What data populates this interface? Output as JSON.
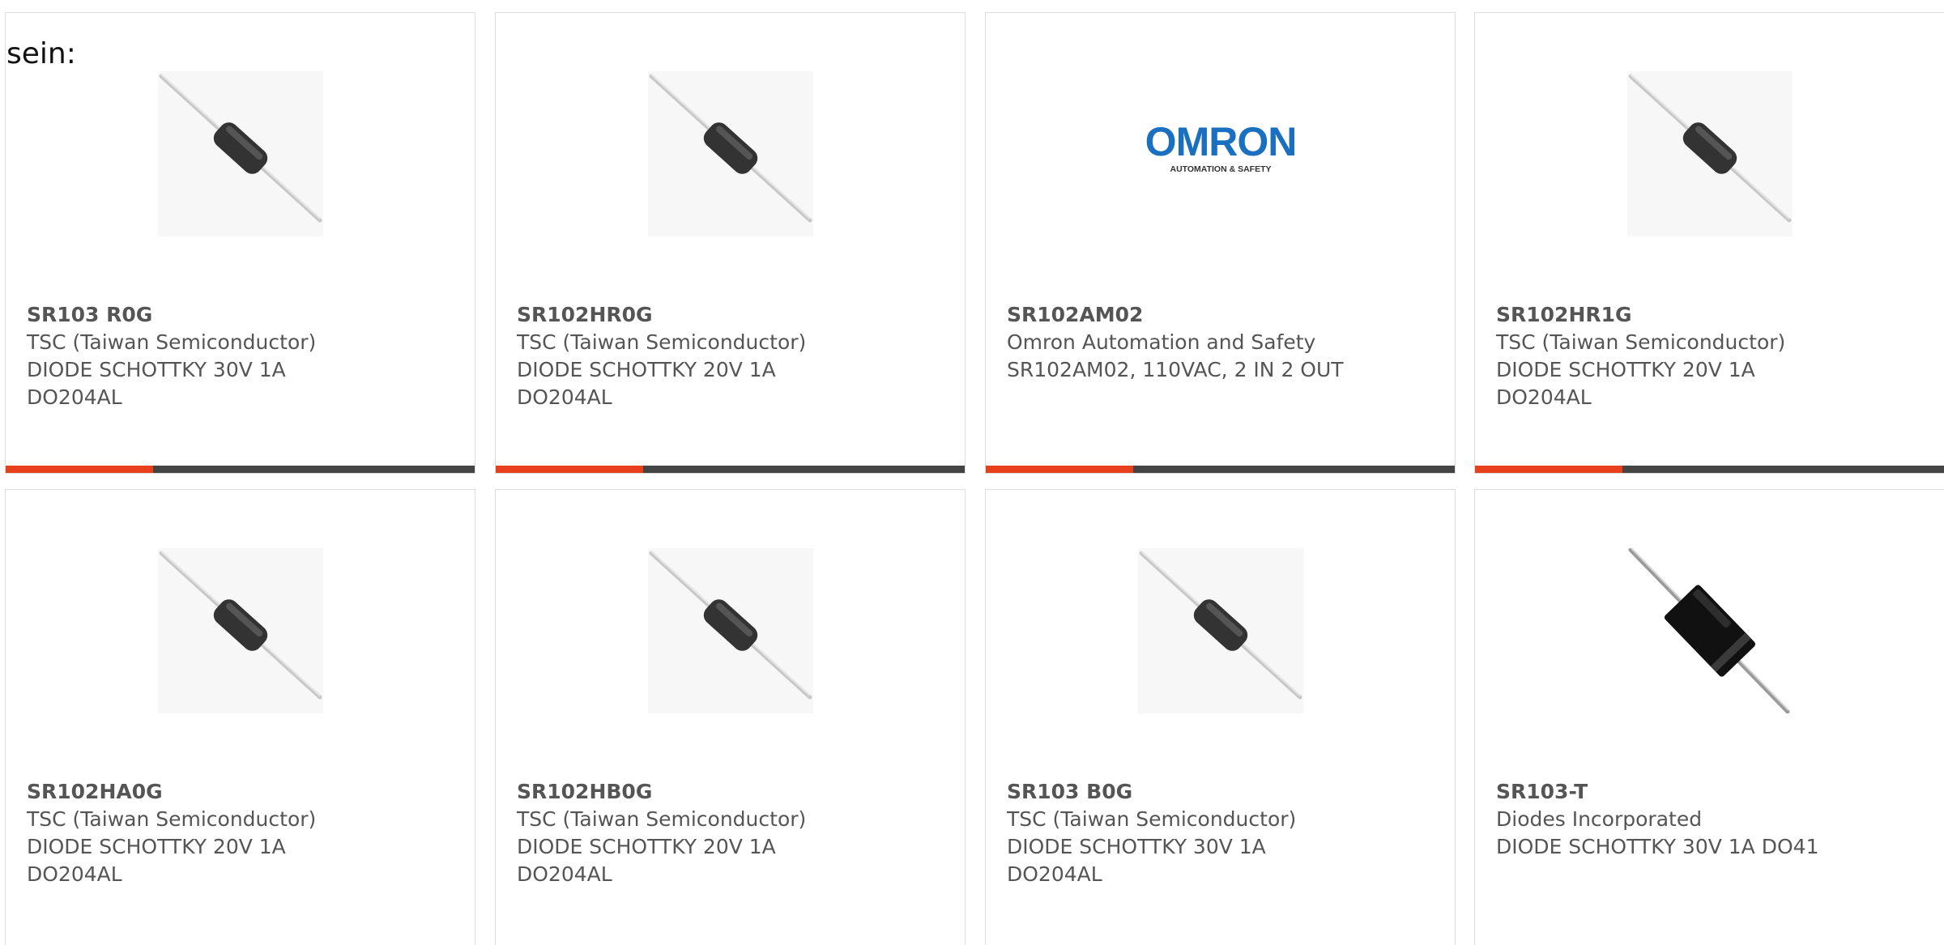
{
  "lead_text": "sein:",
  "products": [
    {
      "part": "SR103 R0G",
      "manufacturer": "TSC (Taiwan Semiconductor)",
      "desc_lines": [
        "DIODE SCHOTTKY 30V 1A",
        "DO204AL"
      ],
      "image": "axial-diode"
    },
    {
      "part": "SR102HR0G",
      "manufacturer": "TSC (Taiwan Semiconductor)",
      "desc_lines": [
        "DIODE SCHOTTKY 20V 1A",
        "DO204AL"
      ],
      "image": "axial-diode"
    },
    {
      "part": "SR102AM02",
      "manufacturer": "Omron Automation and Safety",
      "desc_lines": [
        "SR102AM02, 110VAC, 2 IN 2 OUT"
      ],
      "image": "omron-logo"
    },
    {
      "part": "SR102HR1G",
      "manufacturer": "TSC (Taiwan Semiconductor)",
      "desc_lines": [
        "DIODE SCHOTTKY 20V 1A",
        "DO204AL"
      ],
      "image": "axial-diode"
    },
    {
      "part": "SR102HA0G",
      "manufacturer": "TSC (Taiwan Semiconductor)",
      "desc_lines": [
        "DIODE SCHOTTKY 20V 1A",
        "DO204AL"
      ],
      "image": "axial-diode"
    },
    {
      "part": "SR102HB0G",
      "manufacturer": "TSC (Taiwan Semiconductor)",
      "desc_lines": [
        "DIODE SCHOTTKY 20V 1A",
        "DO204AL"
      ],
      "image": "axial-diode"
    },
    {
      "part": "SR103 B0G",
      "manufacturer": "TSC (Taiwan Semiconductor)",
      "desc_lines": [
        "DIODE SCHOTTKY 30V 1A",
        "DO204AL"
      ],
      "image": "axial-diode"
    },
    {
      "part": "SR103-T",
      "manufacturer": "Diodes Incorporated",
      "desc_lines": [
        "DIODE SCHOTTKY 30V 1A DO41"
      ],
      "image": "axial-diode-do41"
    }
  ],
  "omron_logo": {
    "wordmark": "OMRON",
    "tagline": "AUTOMATION & SAFETY",
    "color": "#1a6fc0"
  },
  "colors": {
    "accent": "#e8401c",
    "bar": "#444444",
    "border": "#dcdcdc",
    "text": "#555555"
  }
}
